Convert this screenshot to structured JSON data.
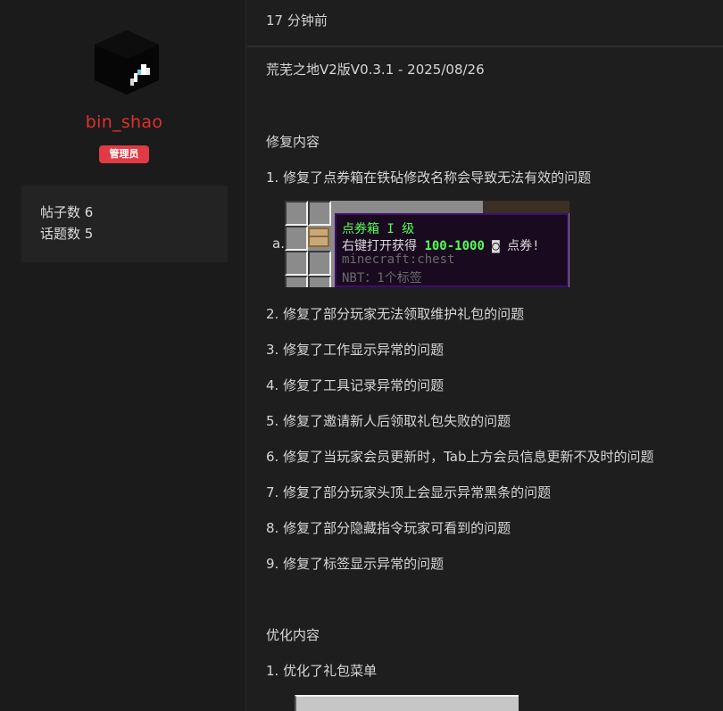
{
  "author": {
    "username": "bin_shao",
    "role": "管理员",
    "stats": {
      "posts": "帖子数 6",
      "topics": "话题数 5"
    }
  },
  "post": {
    "time": "17 分钟前",
    "title": "荒芜之地V2版V0.3.1 - 2025/08/26",
    "fix_heading": "修复内容",
    "fixes": [
      "1. 修复了点券箱在铁砧修改名称会导致无法有效的问题",
      "2. 修复了部分玩家无法领取维护礼包的问题",
      "3. 修复了工作显示异常的问题",
      "4. 修复了工具记录异常的问题",
      "5. 修复了邀请新人后领取礼包失败的问题",
      "6. 修复了当玩家会员更新时，Tab上方会员信息更新不及时的问题",
      "7. 修复了部分玩家头顶上会显示异常黑条的问题",
      "8. 修复了部分隐藏指令玩家可看到的问题",
      "9. 修复了标签显示异常的问题"
    ],
    "sub_marker": "a.",
    "tooltip": {
      "title": "点券箱 I 级",
      "line2_prefix": "右键打开获得 ",
      "line2_amount": "100-1000",
      "line2_suffix": " ◙ 点券!",
      "line3": "minecraft:chest",
      "line4": "NBT：1个标签"
    },
    "optimize_heading": "优化内容",
    "optimizations": [
      "1. 优化了礼包菜单"
    ]
  }
}
